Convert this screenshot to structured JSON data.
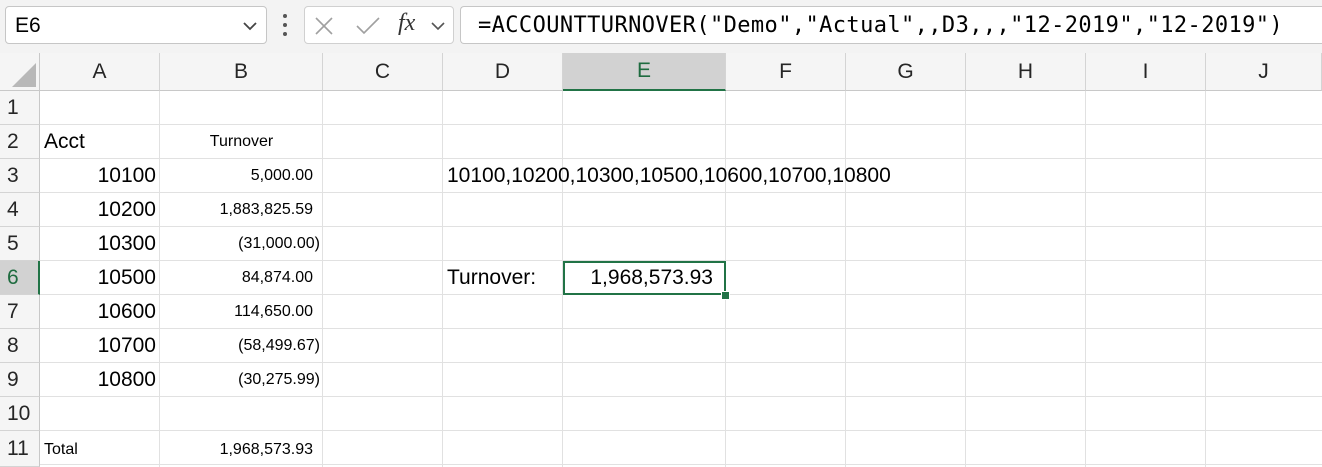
{
  "formula_bar": {
    "name_box": "E6",
    "formula": "=ACCOUNTTURNOVER(\"Demo\",\"Actual\",,D3,,,\"12-2019\",\"12-2019\")",
    "fx_label": "fx"
  },
  "columns": [
    "A",
    "B",
    "C",
    "D",
    "E",
    "F",
    "G",
    "H",
    "I",
    "J"
  ],
  "rows": [
    "1",
    "2",
    "3",
    "4",
    "5",
    "6",
    "7",
    "8",
    "9",
    "10",
    "11"
  ],
  "active_cell": {
    "column": "E",
    "row": "6"
  },
  "cells": {
    "A2": "Acct",
    "B2": "Turnover",
    "A3": "10100",
    "B3": "5,000.00",
    "D3": "10100,10200,10300,10500,10600,10700,10800",
    "A4": "10200",
    "B4": "1,883,825.59",
    "A5": "10300",
    "B5": "(31,000.00)",
    "A6": "10500",
    "B6": "84,874.00",
    "D6": "Turnover:",
    "E6": "1,968,573.93",
    "A7": "10600",
    "B7": "114,650.00",
    "A8": "10700",
    "B8": "(58,499.67)",
    "A9": "10800",
    "B9": "(30,275.99)",
    "A11": "Total",
    "B11": "1,968,573.93"
  },
  "colors": {
    "accent": "#217346",
    "header_bg": "#f5f5f5",
    "active_header_bg": "#d2d2d2",
    "gridline": "#e1e1e1"
  },
  "icons": [
    "chevron-down-icon",
    "more-options-icon",
    "cancel-icon",
    "enter-icon",
    "insert-function-icon",
    "select-all-icon"
  ]
}
